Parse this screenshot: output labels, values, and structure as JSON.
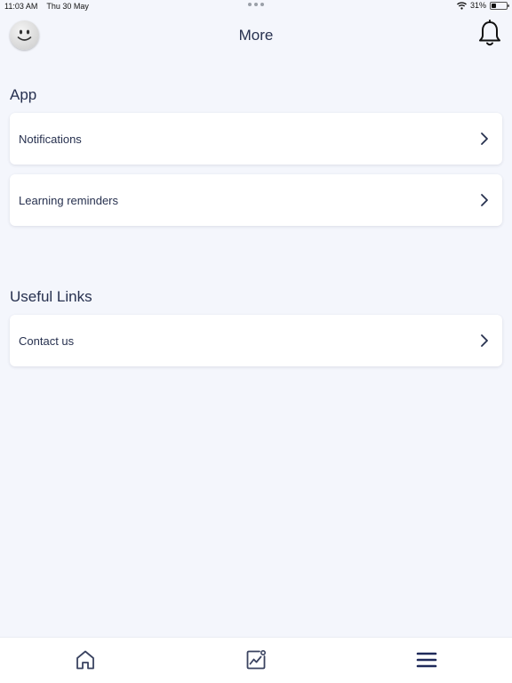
{
  "status": {
    "time": "11:03 AM",
    "date": "Thu 30 May",
    "battery_percent": "31%",
    "battery_level": 0.31,
    "icons": [
      "wifi-icon",
      "battery-icon"
    ]
  },
  "header": {
    "title": "More",
    "avatar_icon": "smiley-avatar-icon",
    "notification_icon": "bell-icon"
  },
  "sections": {
    "app": {
      "title": "App",
      "items": [
        {
          "label": "Notifications",
          "icon": "chevron-right-icon"
        },
        {
          "label": "Learning reminders",
          "icon": "chevron-right-icon"
        }
      ]
    },
    "links": {
      "title": "Useful Links",
      "items": [
        {
          "label": "Contact us",
          "icon": "chevron-right-icon"
        }
      ]
    }
  },
  "tab_bar": {
    "tabs": [
      {
        "icon": "home-icon"
      },
      {
        "icon": "progress-chart-icon"
      },
      {
        "icon": "menu-icon",
        "active": true
      }
    ]
  },
  "colors": {
    "background": "#f4f6fc",
    "card": "#ffffff",
    "text": "#27314f",
    "active_tab": "#1f2a5a"
  }
}
